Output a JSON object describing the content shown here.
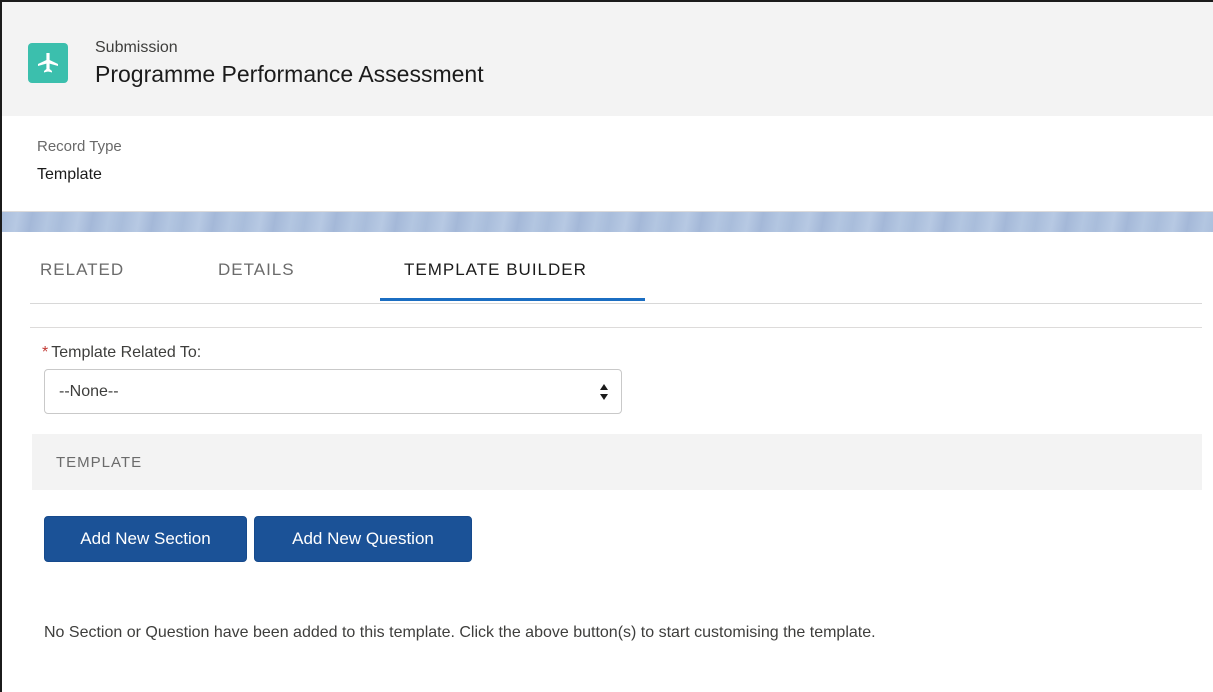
{
  "header": {
    "icon": "airplane-icon",
    "icon_color": "#3bbfad",
    "object_label": "Submission",
    "record_title": "Programme Performance Assessment"
  },
  "highlights": {
    "field_label": "Record Type",
    "field_value": "Template"
  },
  "tabs": [
    {
      "label": "RELATED",
      "active": false
    },
    {
      "label": "DETAILS",
      "active": false
    },
    {
      "label": "TEMPLATE BUILDER",
      "active": true
    }
  ],
  "form": {
    "required_marker": "*",
    "related_to_label": "Template Related To:",
    "related_to_value": "--None--"
  },
  "section": {
    "title": "TEMPLATE"
  },
  "buttons": {
    "add_section": "Add New Section",
    "add_question": "Add New Question",
    "color": "#1b5297"
  },
  "empty_message": "No Section or Question have been added to this template. Click the above button(s) to start customising the template."
}
